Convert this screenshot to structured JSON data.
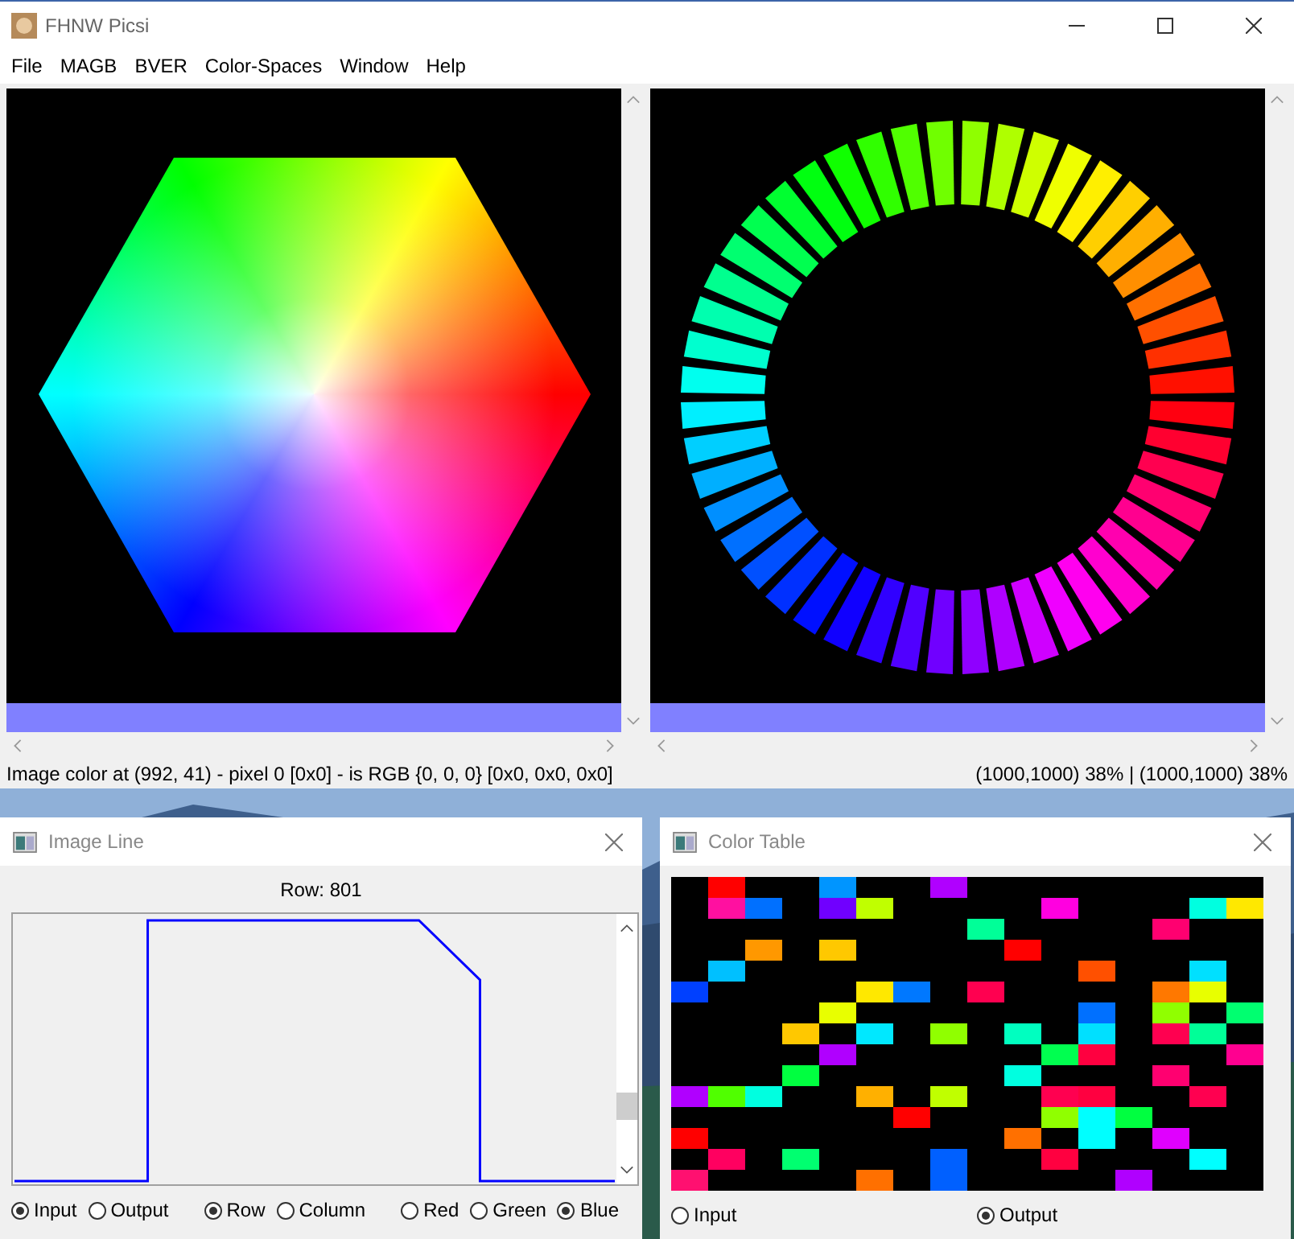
{
  "window": {
    "title": "FHNW Picsi"
  },
  "menu": [
    "File",
    "MAGB",
    "BVER",
    "Color-Spaces",
    "Window",
    "Help"
  ],
  "status_bar": {
    "left": "Image color at (992, 41) - pixel 0 [0x0] - is RGB {0, 0, 0} [0x0, 0x0, 0x0]",
    "right": "(1000,1000) 38% | (1000,1000) 38%"
  },
  "image_line": {
    "title": "Image Line",
    "row_label": "Row: 801",
    "radio_groups": [
      [
        {
          "label": "Input",
          "selected": true
        },
        {
          "label": "Output",
          "selected": false
        }
      ],
      [
        {
          "label": "Row",
          "selected": true
        },
        {
          "label": "Column",
          "selected": false
        }
      ],
      [
        {
          "label": "Red",
          "selected": false
        },
        {
          "label": "Green",
          "selected": false
        },
        {
          "label": "Blue",
          "selected": true
        }
      ]
    ]
  },
  "color_table": {
    "title": "Color Table",
    "radios": [
      {
        "label": "Input",
        "selected": false
      },
      {
        "label": "Output",
        "selected": true
      }
    ]
  }
}
